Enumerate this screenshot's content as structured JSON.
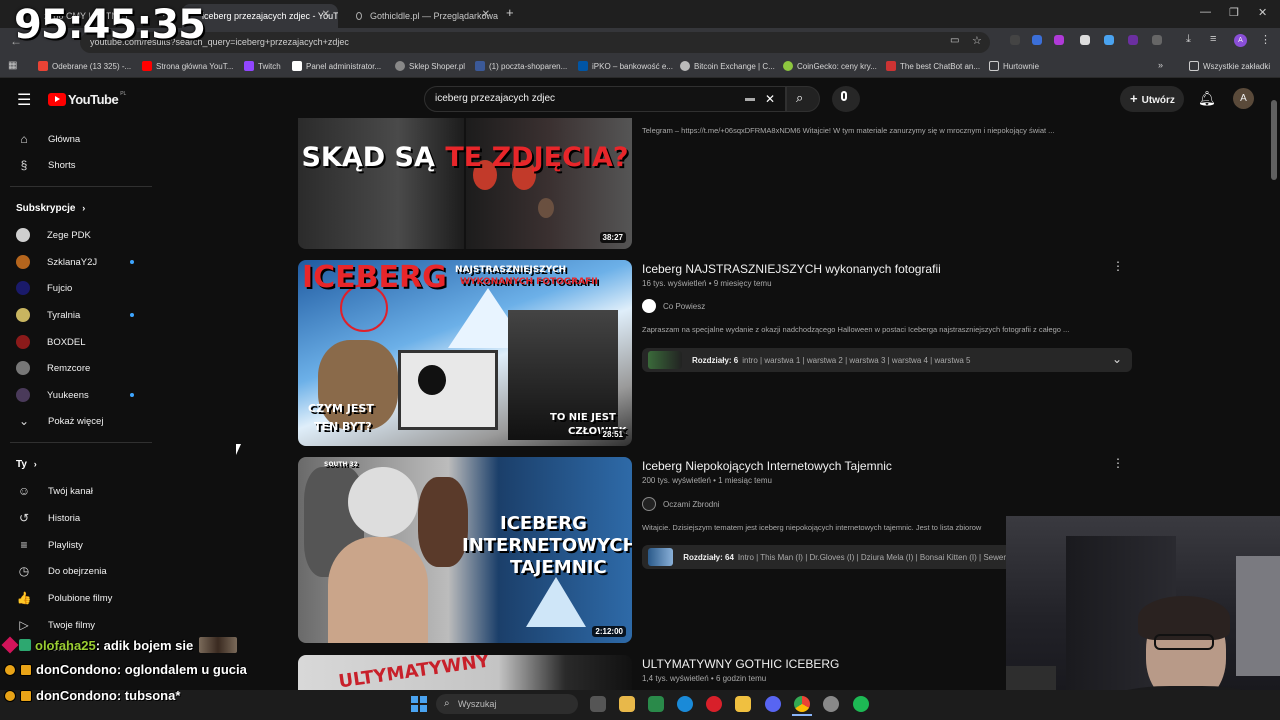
{
  "overlay": {
    "timer": "95:45:35"
  },
  "browser": {
    "tabs": [
      {
        "title": "zego CMY | NETNET",
        "active": false
      },
      {
        "title": "iceberg przezajacych zdjec - YouTube",
        "active": true
      },
      {
        "title": "Gothicldle.pl — Przeglądarkowa",
        "active": false
      }
    ],
    "new_tab_label": "+",
    "url": "youtube.com/results?search_query=iceberg+przezajacych+zdjec",
    "bookmarks": [
      {
        "label": "Odebrane (13 325) -...",
        "color": "#ea4335"
      },
      {
        "label": "Strona główna YouT...",
        "color": "#ff0000"
      },
      {
        "label": "Twitch",
        "color": "#9146ff"
      },
      {
        "label": "Panel administrator...",
        "color": "#ffffff"
      },
      {
        "label": "Sklep Shoper.pl",
        "color": "#888888"
      },
      {
        "label": "(1) poczta-shoparen...",
        "color": "#3b5998"
      },
      {
        "label": "iPKO – bankowość e...",
        "color": "#0055a5"
      },
      {
        "label": "Bitcoin Exchange | C...",
        "color": "#bbbbbb"
      },
      {
        "label": "CoinGecko: ceny kry...",
        "color": "#8dc63f"
      },
      {
        "label": "The best ChatBot an...",
        "color": "#cc3333"
      },
      {
        "label": "Hurtownie",
        "color": "#cccccc"
      }
    ],
    "all_bookmarks_label": "Wszystkie zakładki"
  },
  "youtube": {
    "logo_text": "YouTube",
    "logo_region": "PL",
    "search_value": "iceberg przezajacych zdjec",
    "create_label": "Utwórz",
    "avatar_letter": "A"
  },
  "sidebar": {
    "main": [
      {
        "label": "Główna",
        "icon": "home-icon",
        "glyph": "⌂"
      },
      {
        "label": "Shorts",
        "icon": "shorts-icon",
        "glyph": "§"
      }
    ],
    "subscriptions_heading": "Subskrypcje",
    "subscriptions": [
      {
        "label": "Zege PDK",
        "color": "#cfcfcf",
        "dot": false
      },
      {
        "label": "SzklanaY2J",
        "color": "#b5651d",
        "dot": true
      },
      {
        "label": "Fujcio",
        "color": "#1a1a6a",
        "dot": false
      },
      {
        "label": "Tyralnia",
        "color": "#c8b560",
        "dot": true
      },
      {
        "label": "BOXDEL",
        "color": "#8b1a1a",
        "dot": false
      },
      {
        "label": "Remzcore",
        "color": "#777777",
        "dot": false
      },
      {
        "label": "Yuukeens",
        "color": "#4a3a5a",
        "dot": true
      }
    ],
    "show_more_label": "Pokaż więcej",
    "you_heading": "Ty",
    "you_items": [
      {
        "label": "Twój kanał",
        "icon": "your-channel-icon",
        "glyph": "☺"
      },
      {
        "label": "Historia",
        "icon": "history-icon",
        "glyph": "↺"
      },
      {
        "label": "Playlisty",
        "icon": "playlists-icon",
        "glyph": "≡"
      },
      {
        "label": "Do obejrzenia",
        "icon": "watch-later-icon",
        "glyph": "◷"
      },
      {
        "label": "Polubione filmy",
        "icon": "liked-icon",
        "glyph": "👍"
      },
      {
        "label": "Twoje filmy",
        "icon": "your-videos-icon",
        "glyph": "▷"
      }
    ],
    "downloads_label": "Pobrane"
  },
  "results": [
    {
      "thumb_text": [
        "SKĄD SĄ",
        "TE ZDJĘCIA?"
      ],
      "duration": "38:27",
      "desc": "Telegram – https://t.me/+06sqxDFRMA8xNDM6 Witajcie! W tym materiale zanurzymy się w mrocznym i niepokojący świat ..."
    },
    {
      "title": "Iceberg NAJSTRASZNIEJSZYCH wykonanych fotografii",
      "meta": "16 tys. wyświetleń • 9 miesięcy temu",
      "channel": "Co Powiesz",
      "desc": "Zapraszam na specjalne wydanie z okazji nadchodzącego Halloween w postaci Iceberga najstraszniejszych fotografii z całego ...",
      "chapters_count": "Rozdziały: 6",
      "chapters_list": "intro | warstwa 1 | warstwa 2 | warstwa 3 | warstwa 4 | warstwa 5",
      "duration": "28:51",
      "thumb_text": [
        "ICEBERG",
        "NAJSTRASZNIEJSZYCH",
        "WYKONANYCH FOTOGRAFII",
        "CZYM JEST",
        "TEN BYT?",
        "TO NIE JEST",
        "CZŁOWIEK"
      ]
    },
    {
      "title": "Iceberg Niepokojących Internetowych Tajemnic",
      "meta": "200 tys. wyświetleń • 1 miesiąc temu",
      "channel": "Oczami Zbrodni",
      "desc": "Witajcie. Dzisiejszym tematem jest iceberg niepokojących internetowych tajemnic. Jest to lista zbiorow",
      "chapters_count": "Rozdziały: 64",
      "chapters_list": "Intro | This Man (I) | Dr.Gloves (I) | Dziura Mela (I) | Bonsai Kitten (I) | Sewer",
      "duration": "2:12:00",
      "thumb_text": [
        "SOUTH 32",
        "ICEBERG",
        "INTERNETOWYCH",
        "TAJEMNIC"
      ]
    },
    {
      "title": "ULTYMATYWNY GOTHIC ICEBERG",
      "meta": "1,4 tys. wyświetleń • 6 godzin temu",
      "thumb_text": [
        "ULTYMATYWNY"
      ]
    }
  ],
  "chat": [
    {
      "user": "olofaha25",
      "text": ": adik bojem sie"
    },
    {
      "user": "donCondono",
      "text": ": oglondalem u gucia"
    },
    {
      "user": "donCondono",
      "text": ": tubsona*"
    }
  ],
  "taskbar": {
    "search_placeholder": "Wyszukaj"
  }
}
